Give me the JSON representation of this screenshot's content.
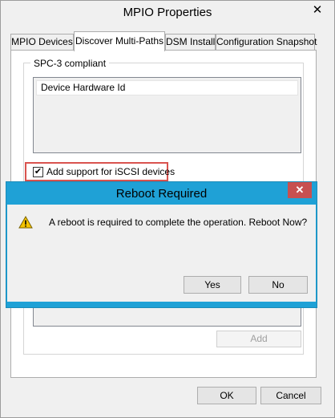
{
  "window": {
    "title": "MPIO Properties",
    "close_glyph": "✕"
  },
  "tabs": [
    {
      "label": "MPIO Devices",
      "active": false
    },
    {
      "label": "Discover Multi-Paths",
      "active": true
    },
    {
      "label": "DSM Install",
      "active": false
    },
    {
      "label": "Configuration Snapshot",
      "active": false
    }
  ],
  "spc3": {
    "group_label": "SPC-3 compliant",
    "column_header": "Device Hardware Id"
  },
  "iscsi": {
    "label": "Add support for iSCSI devices",
    "checked": true,
    "check_glyph": "✔",
    "highlight_color": "#d9534f"
  },
  "add_button": {
    "label": "Add",
    "enabled": false
  },
  "footer": {
    "ok_label": "OK",
    "cancel_label": "Cancel"
  },
  "reboot_dialog": {
    "title": "Reboot Required",
    "close_glyph": "✕",
    "message": "A reboot is required to complete the operation. Reboot Now?",
    "icon": "warning-icon",
    "yes_label": "Yes",
    "no_label": "No",
    "accent_color": "#1fa1d6",
    "close_color": "#c75050"
  }
}
